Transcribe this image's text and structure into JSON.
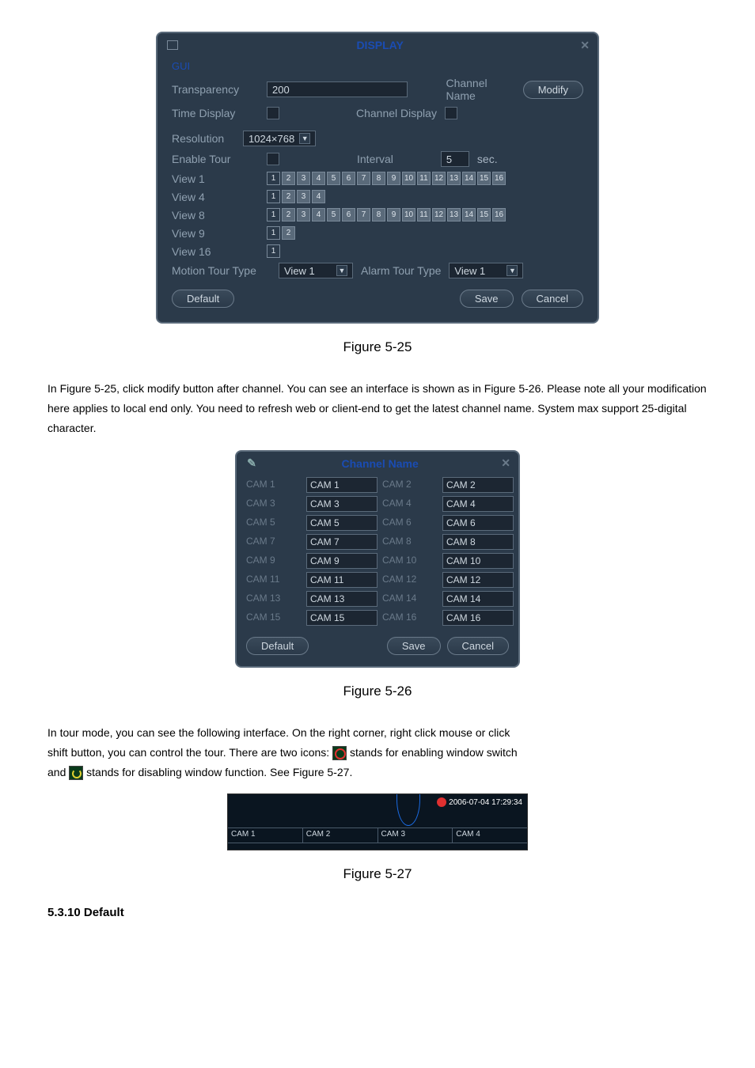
{
  "displayDialog": {
    "title": "DISPLAY",
    "legend": "GUI",
    "transparencyLabel": "Transparency",
    "transparencyValue": "200",
    "channelNameLabel": "Channel Name",
    "modifyBtn": "Modify",
    "timeDisplayLabel": "Time Display",
    "channelDisplayLabel": "Channel Display",
    "resolutionLabel": "Resolution",
    "resolutionValue": "1024×768",
    "enableTourLabel": "Enable Tour",
    "intervalLabel": "Interval",
    "intervalValue": "5",
    "intervalUnit": "sec.",
    "view1Label": "View 1",
    "view4Label": "View 4",
    "view8Label": "View 8",
    "view9Label": "View 9",
    "view16Label": "View 16",
    "motionTourLabel": "Motion Tour Type",
    "motionTourValue": "View 1",
    "alarmTourLabel": "Alarm Tour Type",
    "alarmTourValue": "View 1",
    "defaultBtn": "Default",
    "saveBtn": "Save",
    "cancelBtn": "Cancel",
    "nums16": [
      "1",
      "2",
      "3",
      "4",
      "5",
      "6",
      "7",
      "8",
      "9",
      "10",
      "11",
      "12",
      "13",
      "14",
      "15",
      "16"
    ],
    "nums4": [
      "1",
      "2",
      "3",
      "4"
    ],
    "nums2": [
      "1",
      "2"
    ],
    "nums1": [
      "1"
    ]
  },
  "caption525": "Figure 5-25",
  "para1": "In Figure 5-25, click modify button after channel. You can see an interface is shown as in Figure 5-26. Please note all your modification here applies to local end only. You need to refresh web or client-end to get the latest channel name. System max support 25-digital character.",
  "channelDialog": {
    "title": "Channel Name",
    "rows": [
      {
        "l1": "CAM 1",
        "v1": "CAM 1",
        "l2": "CAM 2",
        "v2": "CAM 2"
      },
      {
        "l1": "CAM 3",
        "v1": "CAM 3",
        "l2": "CAM 4",
        "v2": "CAM 4"
      },
      {
        "l1": "CAM 5",
        "v1": "CAM 5",
        "l2": "CAM 6",
        "v2": "CAM 6"
      },
      {
        "l1": "CAM 7",
        "v1": "CAM 7",
        "l2": "CAM 8",
        "v2": "CAM 8"
      },
      {
        "l1": "CAM 9",
        "v1": "CAM 9",
        "l2": "CAM 10",
        "v2": "CAM 10"
      },
      {
        "l1": "CAM 11",
        "v1": "CAM 11",
        "l2": "CAM 12",
        "v2": "CAM 12"
      },
      {
        "l1": "CAM 13",
        "v1": "CAM 13",
        "l2": "CAM 14",
        "v2": "CAM 14"
      },
      {
        "l1": "CAM 15",
        "v1": "CAM 15",
        "l2": "CAM 16",
        "v2": "CAM 16"
      }
    ],
    "defaultBtn": "Default",
    "saveBtn": "Save",
    "cancelBtn": "Cancel"
  },
  "caption526": "Figure 5-26",
  "para2a": "In tour mode, you can see the following interface. On the right corner, right click mouse or click",
  "para2b": "shift button, you can control the tour. There are two icons: ",
  "para2c": " stands for enabling window switch",
  "para2d": "and ",
  "para2e": " stands for disabling window function. See Figure 5-27.",
  "tourStrip": {
    "timestamp": "2006-07-04 17:29:34",
    "cams": [
      "CAM 1",
      "CAM 2",
      "CAM 3",
      "CAM 4"
    ]
  },
  "caption527": "Figure 5-27",
  "sectionHead": "5.3.10 Default"
}
